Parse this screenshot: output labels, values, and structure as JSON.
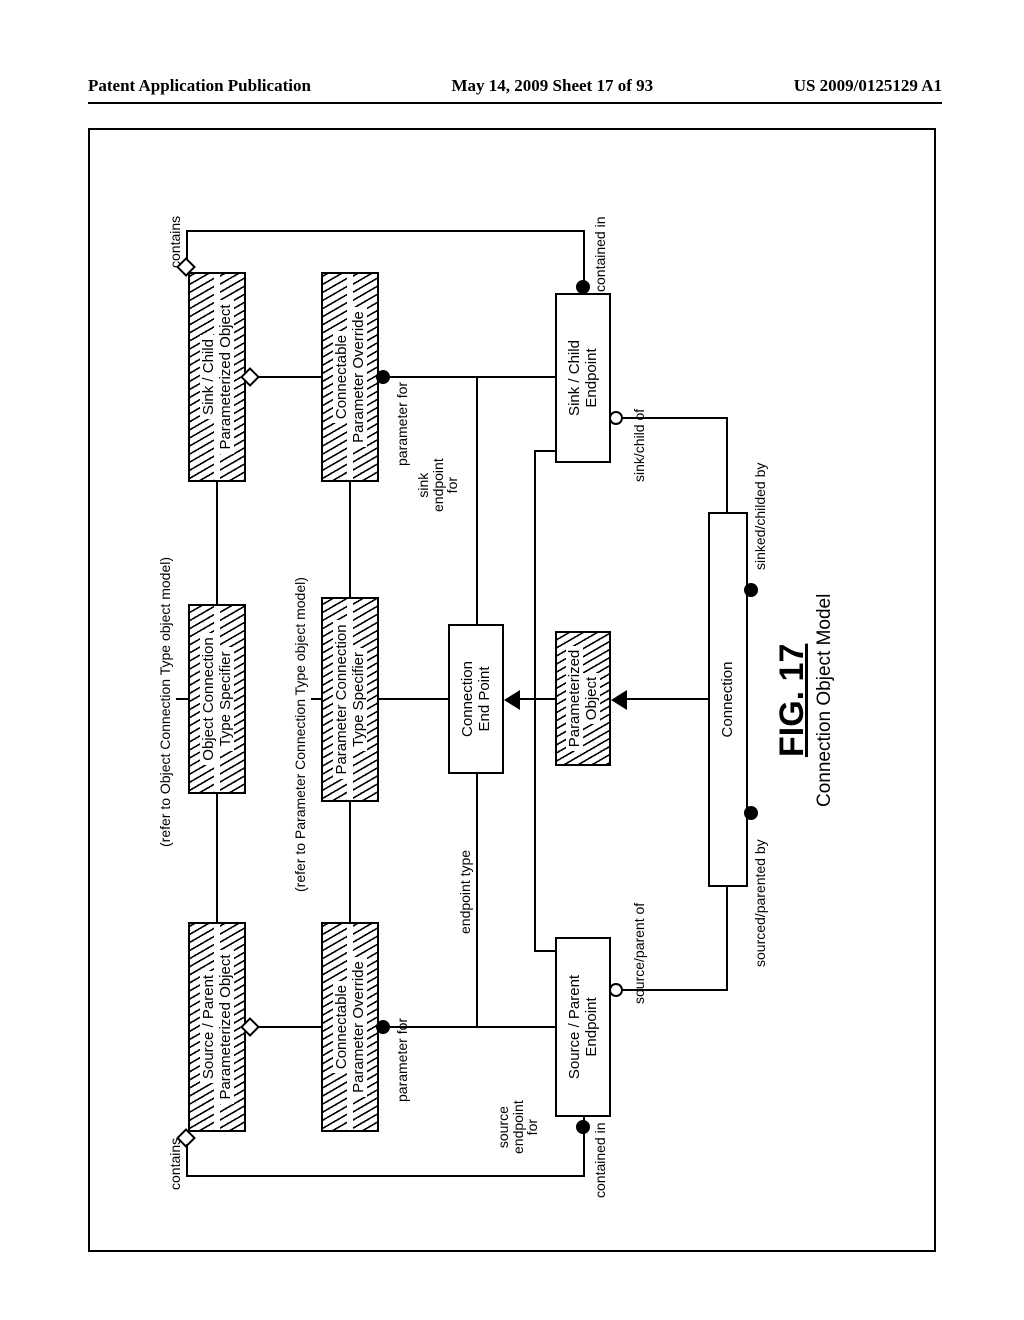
{
  "header": {
    "left": "Patent Application Publication",
    "center": "May 14, 2009  Sheet 17 of 93",
    "right": "US 2009/0125129 A1"
  },
  "figure": {
    "number": "FIG. 17",
    "title": "Connection Object Model"
  },
  "refs": {
    "obj_conn": "(refer to Object Connection Type object model)",
    "param_conn": "(refer to Parameter Connection Type object model)"
  },
  "boxes": {
    "source_parent_paramobj_l1": "Source / Parent",
    "source_parent_paramobj_l2": "Parameterized Object",
    "sink_child_paramobj_l1": "Sink / Child",
    "sink_child_paramobj_l2": "Parameterized Object",
    "obj_conn_type_spec_l1": "Object Connection",
    "obj_conn_type_spec_l2": "Type Specifier",
    "connectable_paramoverride_l_l1": "Connectable",
    "connectable_paramoverride_l_l2": "Parameter Override",
    "connectable_paramoverride_r_l1": "Connectable",
    "connectable_paramoverride_r_l2": "Parameter Override",
    "param_conn_type_spec_l1": "Parameter Connection",
    "param_conn_type_spec_l2": "Type Specifier",
    "connection_endpoint_l1": "Connection",
    "connection_endpoint_l2": "End Point",
    "source_parent_endpoint_l1": "Source / Parent",
    "source_parent_endpoint_l2": "Endpoint",
    "sink_child_endpoint_l1": "Sink / Child",
    "sink_child_endpoint_l2": "Endpoint",
    "parameterized_object_l1": "Parameterized",
    "parameterized_object_l2": "Object",
    "connection": "Connection"
  },
  "labels": {
    "contains_l": "contains",
    "contains_r": "contains",
    "contained_in_l": "contained in",
    "contained_in_r": "contained in",
    "parameter_for_l": "parameter for",
    "parameter_for_r": "parameter for",
    "endpoint_type": "endpoint type",
    "source_endpoint_for": "source\nendpoint\nfor",
    "sink_endpoint_for": "sink\nendpoint\nfor",
    "source_parent_of": "source/parent of",
    "sink_child_of": "sink/child of",
    "sourced_parented_by": "sourced/parented by",
    "sinked_childed_by": "sinked/childed by"
  }
}
